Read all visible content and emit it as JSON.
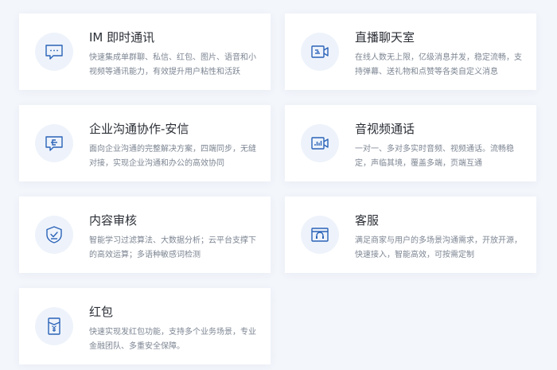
{
  "cards": [
    {
      "title": "IM 即时通讯",
      "desc": "快速集成单群聊、私信、红包、图片、语音和小视频等通讯能力，有效提升用户粘性和活跃",
      "icon": "chat-bubble-icon"
    },
    {
      "title": "直播聊天室",
      "desc": "在线人数无上限，亿级消息并发，稳定流畅，支持弹幕、送礼物和点赞等各类自定义消息",
      "icon": "live-camera-icon"
    },
    {
      "title": "企业沟通协作-安信",
      "desc": "面向企业沟通的完整解决方案，四端同步，无缝对接，实现企业沟通和办公的高效协同",
      "icon": "enterprise-chat-icon"
    },
    {
      "title": "音视频通话",
      "desc": "一对一、多对多实时音频、视频通话。流畅稳定，声临其境，覆盖多端，页端互通",
      "icon": "video-call-icon"
    },
    {
      "title": "内容审核",
      "desc": "智能学习过滤算法、大数据分析；云平台支撑下的高效运算；多语种敏感词检测",
      "icon": "shield-check-icon"
    },
    {
      "title": "客服",
      "desc": "满足商家与用户的多场景沟通需求，开放开源，快速接入，智能高效，可按需定制",
      "icon": "customer-service-icon"
    },
    {
      "title": "红包",
      "desc": "快速实现发红包功能，支持多个业务场景，专业金融团队、多重安全保障。",
      "icon": "red-packet-icon"
    }
  ],
  "colors": {
    "icon_stroke": "#2a63b8",
    "icon_bg": "#eef3fb"
  }
}
